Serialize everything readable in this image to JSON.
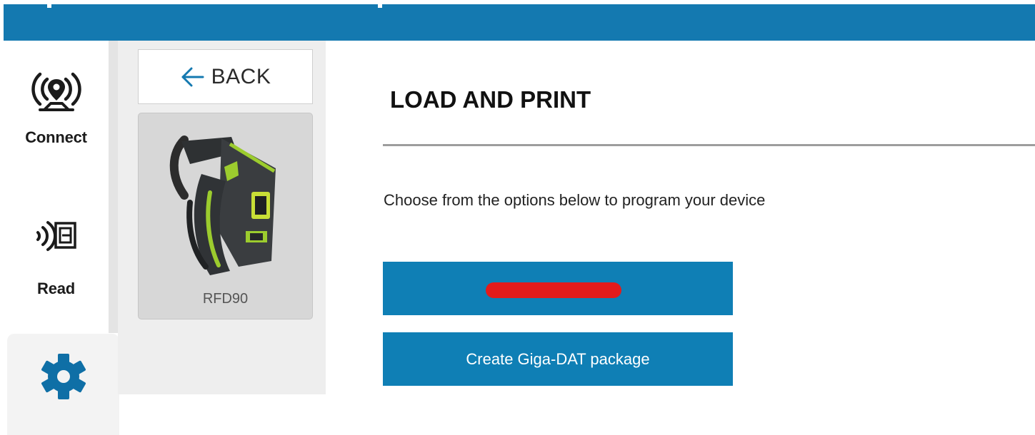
{
  "theme": {
    "header_blue": "#1479b0",
    "button_blue": "#0f7fb5",
    "gear_blue": "#0f6fa6",
    "redaction_red": "#e31b1b"
  },
  "sidebar": {
    "items": [
      {
        "label": "Connect",
        "icon": "location-broadcast-icon"
      },
      {
        "label": "Read",
        "icon": "rfid-read-icon"
      },
      {
        "label": "",
        "icon": "gear-icon",
        "selected": true
      }
    ]
  },
  "device_panel": {
    "back_label": "BACK",
    "back_icon": "arrow-left-icon",
    "device_name": "RFD90"
  },
  "main": {
    "title": "LOAD AND PRINT",
    "description": "Choose from the options below to program your device",
    "buttons": [
      {
        "label": "",
        "redacted": true
      },
      {
        "label": "Create Giga-DAT package"
      }
    ]
  }
}
